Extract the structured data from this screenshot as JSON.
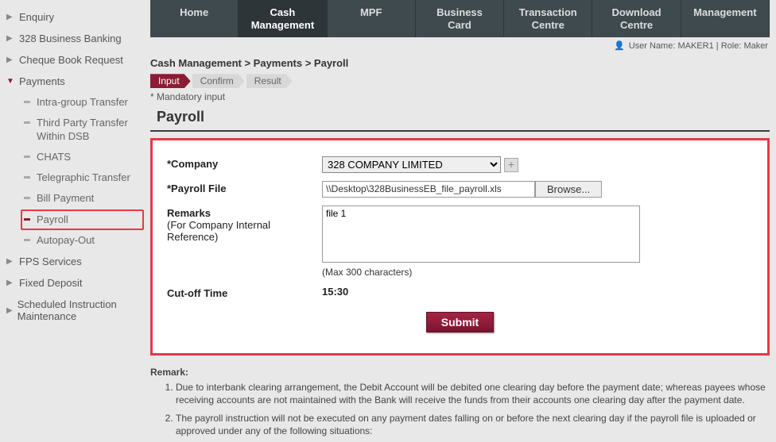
{
  "topnav": {
    "items": [
      {
        "label": "Home"
      },
      {
        "label": "Cash\nManagement"
      },
      {
        "label": "MPF"
      },
      {
        "label": "Business\nCard"
      },
      {
        "label": "Transaction\nCentre"
      },
      {
        "label": "Download\nCentre"
      },
      {
        "label": "Management"
      }
    ],
    "active_index": 1
  },
  "user": {
    "prefix": "User Name: ",
    "name": "MAKER1",
    "role_prefix": " | Role: ",
    "role": "Maker"
  },
  "breadcrumb": "Cash Management > Payments > Payroll",
  "steps": {
    "items": [
      "Input",
      "Confirm",
      "Result"
    ],
    "active_index": 0
  },
  "mandatory_note": "* Mandatory input",
  "page_title": "Payroll",
  "form": {
    "company_label": "*Company",
    "company_value": "328 COMPANY LIMITED",
    "file_label": "*Payroll File",
    "file_value": "\\\\Desktop\\328BusinessEB_file_payroll.xls",
    "browse_label": "Browse...",
    "remarks_label": "Remarks",
    "remarks_sub": "(For Company Internal Reference)",
    "remarks_value": "file 1",
    "char_note": "(Max 300 characters)",
    "cutoff_label": "Cut-off Time",
    "cutoff_value": "15:30",
    "submit_label": "Submit"
  },
  "remark_section": {
    "title": "Remark:",
    "items": [
      "Due to interbank clearing arrangement, the Debit Account will be debited one clearing day before the payment date; whereas payees whose receiving accounts are not maintained with the Bank will receive the funds from their accounts one clearing day after the payment date.",
      "The payroll instruction will not be executed on any payment dates falling on or before the next clearing day if the payroll file is uploaded or approved under any of the following situations:"
    ]
  },
  "sidebar": {
    "items": [
      {
        "label": "Enquiry",
        "expandable": true
      },
      {
        "label": "328 Business Banking",
        "expandable": true
      },
      {
        "label": "Cheque Book Request",
        "expandable": true
      },
      {
        "label": "Payments",
        "expandable": true,
        "open": true,
        "children": [
          {
            "label": "Intra-group Transfer"
          },
          {
            "label": "Third Party Transfer Within DSB"
          },
          {
            "label": "CHATS"
          },
          {
            "label": "Telegraphic Transfer"
          },
          {
            "label": "Bill Payment"
          },
          {
            "label": "Payroll",
            "selected": true
          },
          {
            "label": "Autopay-Out"
          }
        ]
      },
      {
        "label": "FPS Services",
        "expandable": true
      },
      {
        "label": "Fixed Deposit",
        "expandable": true
      },
      {
        "label": "Scheduled Instruction Maintenance",
        "expandable": true
      }
    ]
  }
}
